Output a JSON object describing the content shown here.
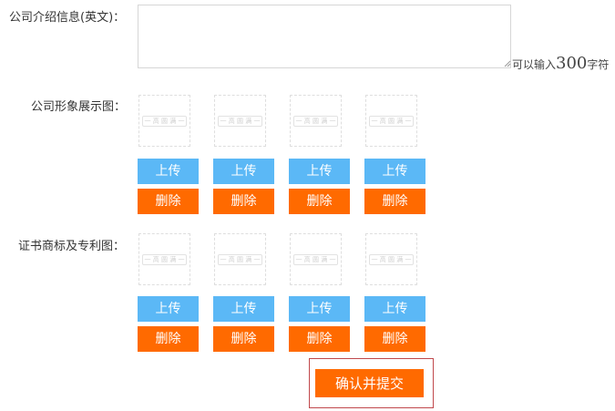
{
  "form": {
    "intro_label": "公司介绍信息(英文)：",
    "intro_value": "",
    "hint_prefix": "可以输入",
    "hint_count": "300",
    "hint_suffix": "字符",
    "showcase_label": "公司形象展示图：",
    "cert_label": "证书商标及专利图："
  },
  "placeholder_text": "一 高 圆 满 一",
  "buttons": {
    "upload": "上传",
    "delete": "删除",
    "submit": "确认并提交"
  },
  "colors": {
    "upload": "#5bb8f6",
    "delete": "#ff6a00",
    "submit": "#ff6a00",
    "submit_border": "#c0484c"
  }
}
